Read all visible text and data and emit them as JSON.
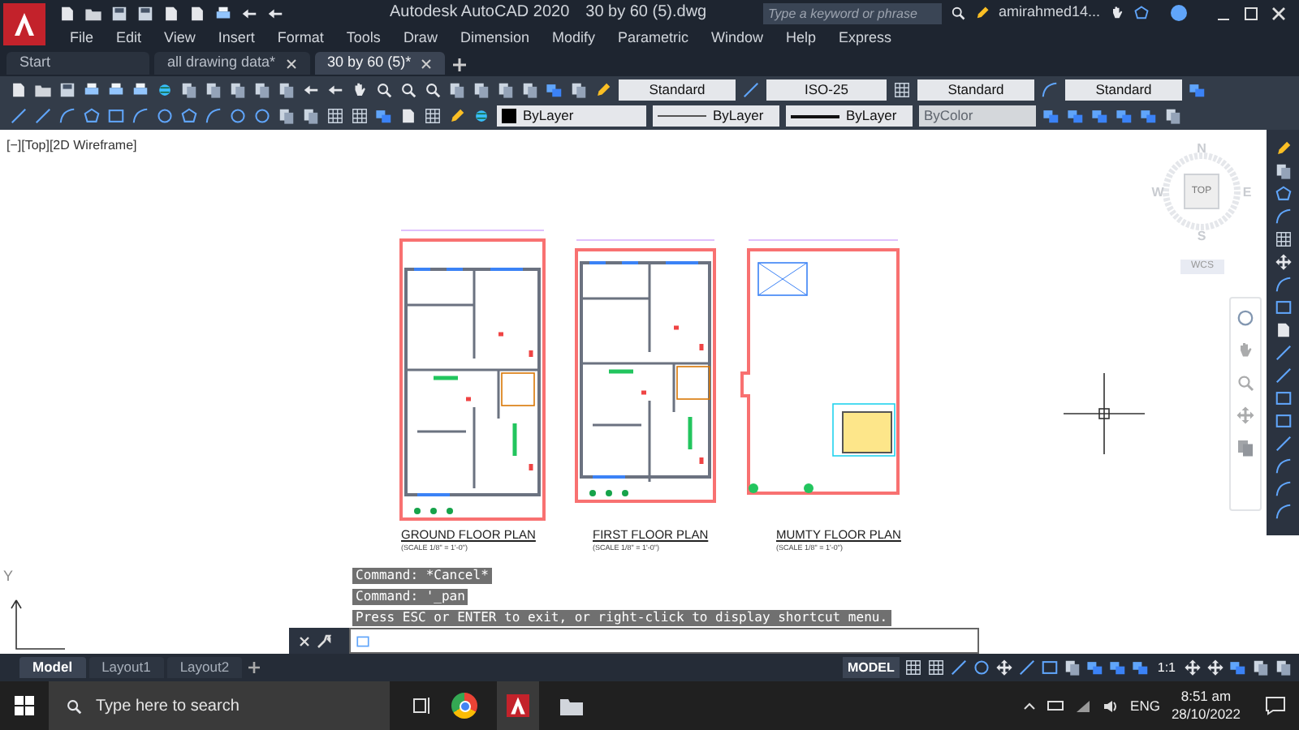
{
  "title_bar": {
    "app": "Autodesk AutoCAD 2020",
    "file": "30 by 60 (5).dwg",
    "search_placeholder": "Type a keyword or phrase",
    "user": "amirahmed14..."
  },
  "menu": [
    "File",
    "Edit",
    "View",
    "Insert",
    "Format",
    "Tools",
    "Draw",
    "Dimension",
    "Modify",
    "Parametric",
    "Window",
    "Help",
    "Express"
  ],
  "doc_tabs": [
    {
      "label": "Start",
      "selected": false,
      "closable": false
    },
    {
      "label": "all drawing data*",
      "selected": false,
      "closable": true
    },
    {
      "label": "30 by 60 (5)*",
      "selected": true,
      "closable": true
    }
  ],
  "styles": [
    {
      "kind": "text",
      "value": "Standard"
    },
    {
      "kind": "dimension",
      "value": "ISO-25"
    },
    {
      "kind": "table",
      "value": "Standard"
    },
    {
      "kind": "multileader",
      "value": "Standard"
    }
  ],
  "properties": [
    {
      "kind": "color",
      "value": "ByLayer",
      "disabled": false
    },
    {
      "kind": "linetype",
      "value": "ByLayer",
      "disabled": false
    },
    {
      "kind": "lineweight",
      "value": "ByLayer",
      "disabled": false
    },
    {
      "kind": "plotstyle",
      "value": "ByColor",
      "disabled": true
    }
  ],
  "viewport": {
    "label": "[−][Top][2D Wireframe]",
    "viewcube": {
      "north": "N",
      "south": "S",
      "east": "E",
      "west": "W",
      "face": "TOP",
      "ucs": "WCS"
    },
    "ucs_axis": "Y"
  },
  "plans": [
    {
      "kind": "ground",
      "title": "GROUND FLOOR PLAN",
      "scale": "(SCALE 1/8\" = 1'-0\")"
    },
    {
      "kind": "first",
      "title": "FIRST FLOOR PLAN",
      "scale": "(SCALE 1/8\" = 1'-0\")"
    },
    {
      "kind": "mumty",
      "title": "MUMTY FLOOR PLAN",
      "scale": "(SCALE 1/8\" = 1'-0\")"
    }
  ],
  "command": {
    "history": [
      "Command: *Cancel*",
      "Command: '_pan",
      "Press ESC or ENTER to exit, or right-click to display shortcut menu."
    ]
  },
  "layout_tabs": [
    {
      "label": "Model",
      "selected": true
    },
    {
      "label": "Layout1",
      "selected": false
    },
    {
      "label": "Layout2",
      "selected": false
    }
  ],
  "status_bar": {
    "space": "MODEL",
    "scale": "1:1"
  },
  "taskbar": {
    "search_placeholder": "Type here to search",
    "language": "ENG",
    "time": "8:51 am",
    "date": "28/10/2022"
  }
}
